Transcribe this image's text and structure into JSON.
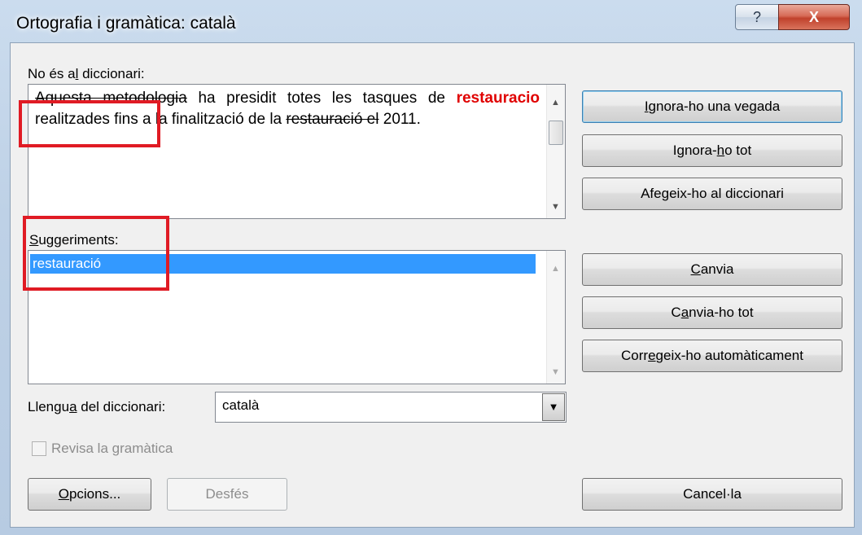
{
  "window": {
    "title": "Ortografia i gramàtica: català",
    "help_glyph": "?",
    "close_glyph": "X"
  },
  "not_in_dictionary": {
    "label_pre": "No és a",
    "label_u": "l",
    "label_post": " diccionari:",
    "line1_strike_a": "Aquesta met",
    "line1_strike_b": "odologia",
    "line1_rest": " ha presidit totes les tasques de",
    "error_word": "restauracio",
    "after_error_cut": " r",
    "after_error_rest": "ealitzades fins a la finalització de la",
    "line3_strike": "restauració el",
    "line3_rest": " 2011."
  },
  "suggestions": {
    "label_u": "S",
    "label_rest": "uggeriments:",
    "items": [
      "restauració"
    ]
  },
  "buttons": {
    "ignore_once_u": "I",
    "ignore_once_rest": "gnora-ho una vegada",
    "ignore_all_pre": "Ignora-",
    "ignore_all_u": "h",
    "ignore_all_post": "o tot",
    "add_pre": "Afe",
    "add_u": "g",
    "add_post": "eix-ho al diccionari",
    "change_u": "C",
    "change_rest": "anvia",
    "change_all_pre": "C",
    "change_all_u": "a",
    "change_all_post": "nvia-ho tot",
    "autocorrect_pre": "Corr",
    "autocorrect_u": "e",
    "autocorrect_post": "geix-ho automàticament",
    "options_u": "O",
    "options_rest": "pcions...",
    "undo": "Desfés",
    "cancel": "Cancel·la"
  },
  "language": {
    "label_pre": "Llengu",
    "label_u": "a",
    "label_post": " del diccionari:",
    "value": "català"
  },
  "grammar_check": {
    "label": "Revisa la gramàtica",
    "checked": false,
    "enabled": false
  },
  "colors": {
    "error_red": "#e00000",
    "highlight_box": "#e01b24",
    "selection_blue": "#3399ff"
  }
}
